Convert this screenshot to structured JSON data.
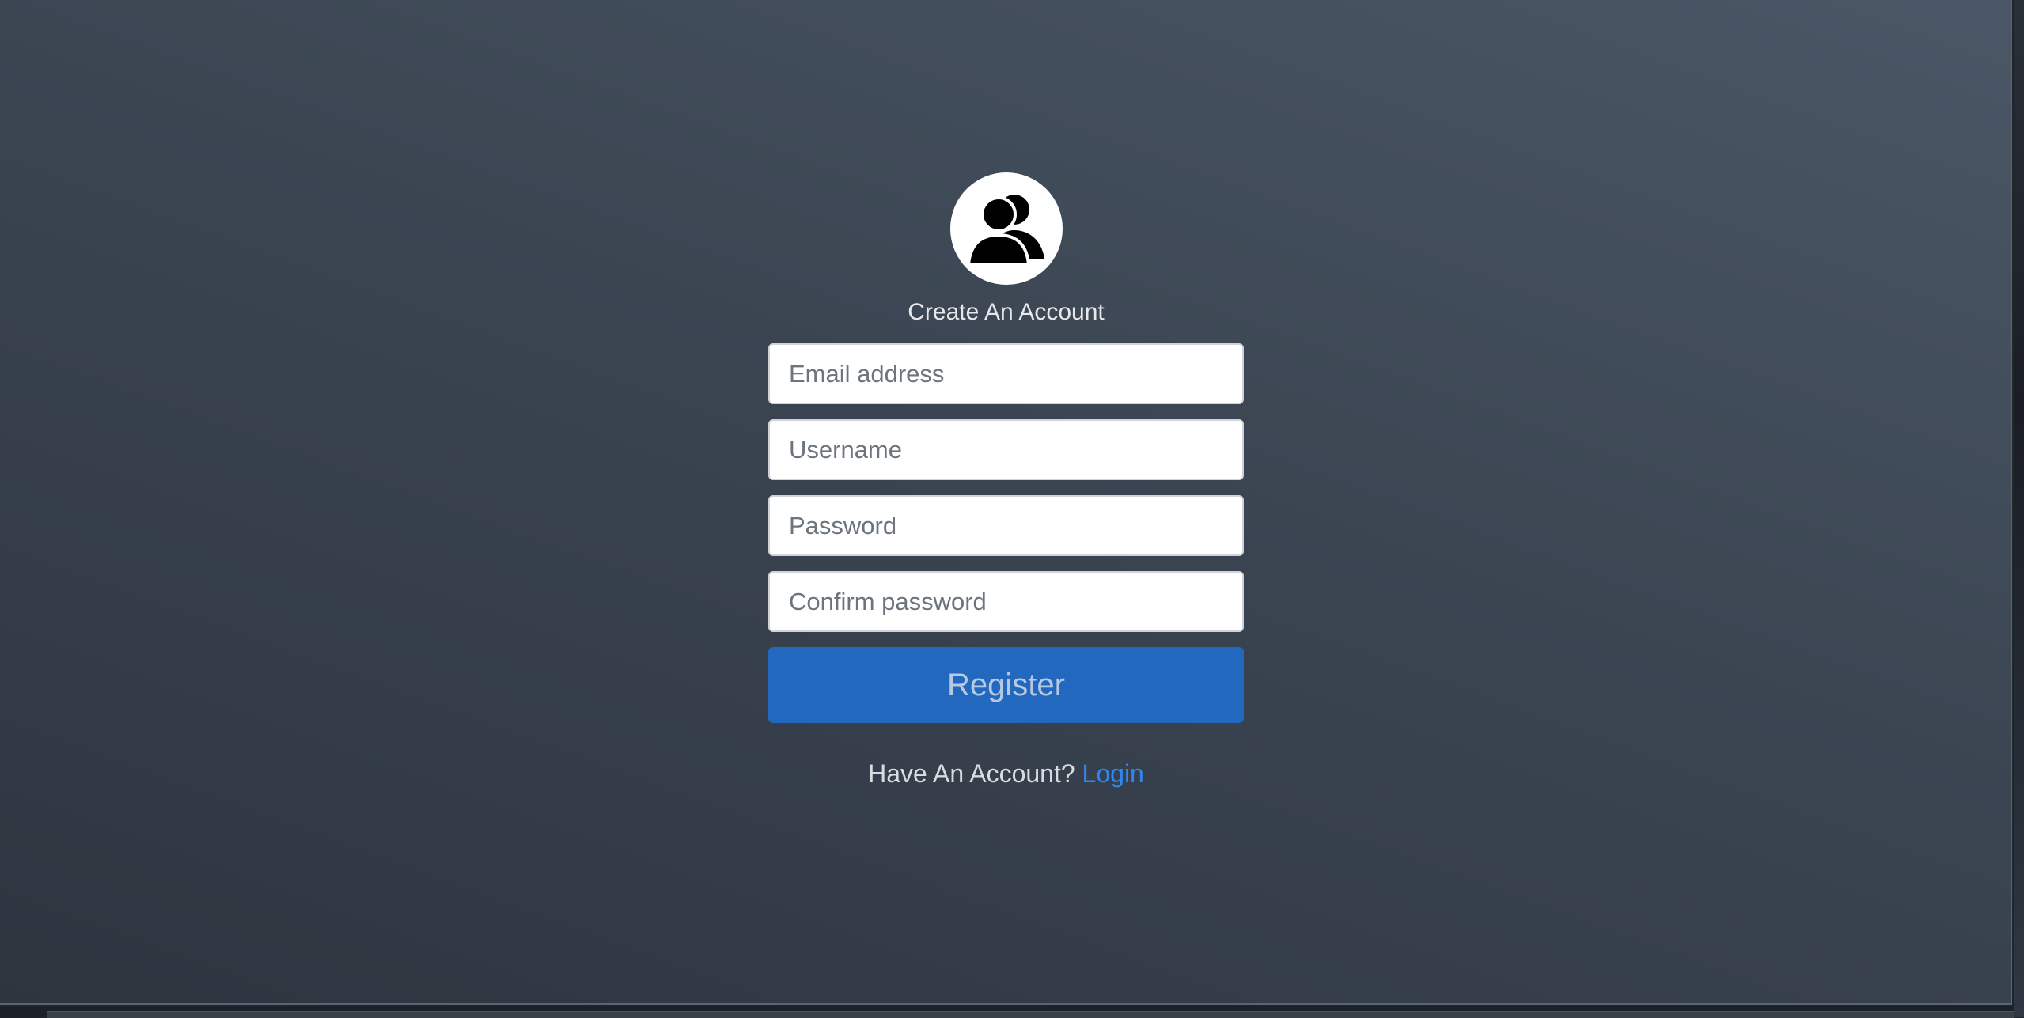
{
  "form": {
    "heading": "Create An Account",
    "avatar_icon": "users-icon",
    "fields": [
      {
        "name": "email",
        "placeholder": "Email address",
        "type": "email",
        "value": ""
      },
      {
        "name": "username",
        "placeholder": "Username",
        "type": "text",
        "value": ""
      },
      {
        "name": "password",
        "placeholder": "Password",
        "type": "password",
        "value": ""
      },
      {
        "name": "confirm_password",
        "placeholder": "Confirm password",
        "type": "password",
        "value": ""
      }
    ],
    "submit_label": "Register",
    "footer_text": "Have An Account?",
    "login_link": "Login"
  },
  "colors": {
    "accent": "#2168be",
    "link": "#2f86f0",
    "background": "#3b4552"
  }
}
